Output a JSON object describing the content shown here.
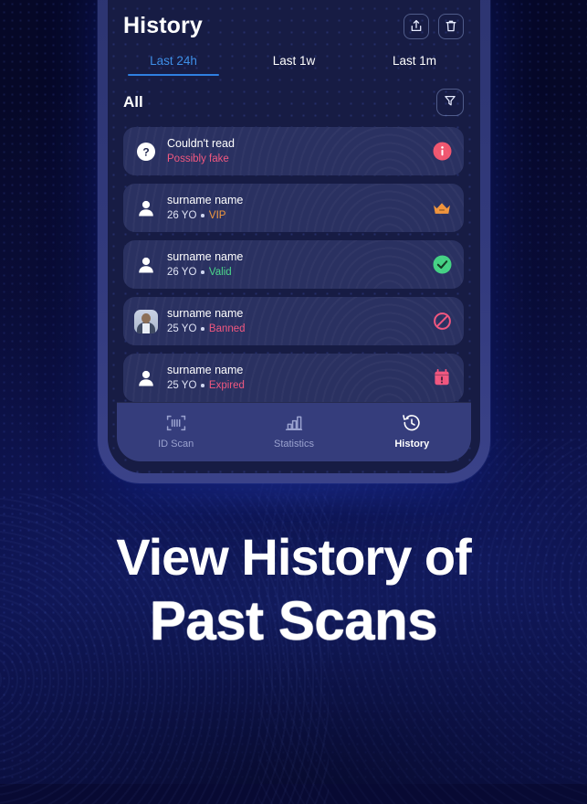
{
  "app": {
    "screen_title": "History"
  },
  "header": {
    "title": "History",
    "actions": [
      {
        "name": "share-button",
        "icon": "share-icon"
      },
      {
        "name": "delete-button",
        "icon": "trash-icon"
      }
    ]
  },
  "tabs": [
    {
      "label": "Last 24h",
      "active": true
    },
    {
      "label": "Last 1w",
      "active": false
    },
    {
      "label": "Last 1m",
      "active": false
    }
  ],
  "filter": {
    "label": "All",
    "icon": "filter-icon"
  },
  "list": [
    {
      "name": "Couldn't read",
      "age": "",
      "status": "Possibly fake",
      "status_color": "#f0567f",
      "avatar": "question-icon",
      "badge": "info-badge"
    },
    {
      "name": "surname name",
      "age": "26 YO",
      "status": "VIP",
      "status_color": "#f2993f",
      "avatar": "person-icon",
      "badge": "crown-badge"
    },
    {
      "name": "surname name",
      "age": "26 YO",
      "status": "Valid",
      "status_color": "#4ad68a",
      "avatar": "person-icon",
      "badge": "check-badge"
    },
    {
      "name": "surname name",
      "age": "25 YO",
      "status": "Banned",
      "status_color": "#f0567f",
      "avatar": "photo-avatar",
      "badge": "ban-badge"
    },
    {
      "name": "surname name",
      "age": "25 YO",
      "status": "Expired",
      "status_color": "#f0567f",
      "avatar": "person-icon",
      "badge": "calendar-alert-badge"
    }
  ],
  "tabbar": [
    {
      "label": "ID Scan",
      "icon": "barcode-scan-icon",
      "active": false
    },
    {
      "label": "Statistics",
      "icon": "bar-chart-icon",
      "active": false
    },
    {
      "label": "History",
      "icon": "clock-history-icon",
      "active": true
    }
  ],
  "headline": {
    "line1": "View History of",
    "line2": "Past Scans"
  },
  "colors": {
    "accent_blue": "#2f7fe0",
    "card_bg": "#2a3161",
    "screen_bg": "#171c44",
    "page_bg": "#0a0d38",
    "danger": "#f0567f",
    "success": "#4ad68a",
    "vip": "#f2993f"
  }
}
